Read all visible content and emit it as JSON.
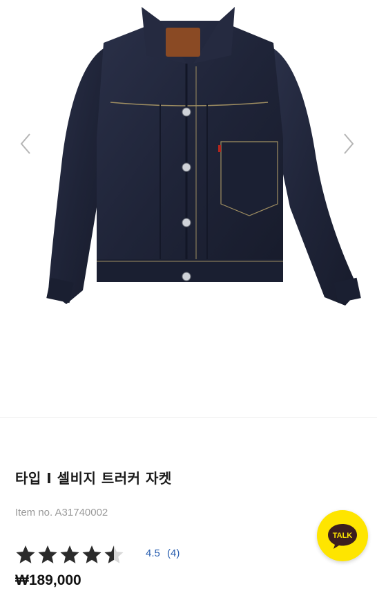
{
  "product": {
    "title": "타입 I 셀비지 트러커 자켓",
    "item_no": "Item no. A31740002",
    "rating": {
      "value": "4.5",
      "count": "(4)",
      "stars": 4.5,
      "max": 5
    },
    "price": "₩189,000"
  },
  "gallery": {
    "prev_icon": "chevron-left-icon",
    "next_icon": "chevron-right-icon"
  },
  "chat": {
    "label": "TALK",
    "color": "#fee500"
  },
  "colors": {
    "denim": "#1f2438",
    "rating_link": "#2a5fb0",
    "muted_text": "#9a9a9a"
  }
}
